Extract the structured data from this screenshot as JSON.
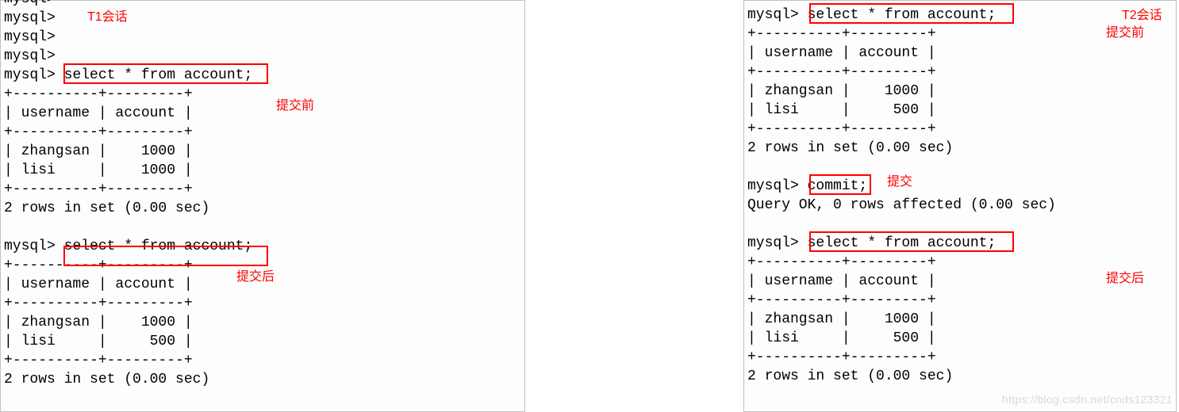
{
  "left": {
    "lines": [
      "mysql>",
      "mysql>",
      "mysql>",
      "mysql>",
      "mysql> select * from account;",
      "+----------+---------+",
      "| username | account |",
      "+----------+---------+",
      "| zhangsan |    1000 |",
      "| lisi     |    1000 |",
      "+----------+---------+",
      "2 rows in set (0.00 sec)",
      "",
      "mysql> select * from account;",
      "+----------+---------+",
      "| username | account |",
      "+----------+---------+",
      "| zhangsan |    1000 |",
      "| lisi     |     500 |",
      "+----------+---------+",
      "2 rows in set (0.00 sec)"
    ],
    "annotations": {
      "session": "T1会话",
      "before": "提交前",
      "after": "提交后"
    }
  },
  "right": {
    "lines": [
      "mysql> select * from account;",
      "+----------+---------+",
      "| username | account |",
      "+----------+---------+",
      "| zhangsan |    1000 |",
      "| lisi     |     500 |",
      "+----------+---------+",
      "2 rows in set (0.00 sec)",
      "",
      "mysql> commit;",
      "Query OK, 0 rows affected (0.00 sec)",
      "",
      "mysql> select * from account;",
      "+----------+---------+",
      "| username | account |",
      "+----------+---------+",
      "| zhangsan |    1000 |",
      "| lisi     |     500 |",
      "+----------+---------+",
      "2 rows in set (0.00 sec)"
    ],
    "annotations": {
      "session": "T2会话",
      "before": "提交前",
      "commit": "提交",
      "after": "提交后"
    }
  },
  "watermark": "https://blog.csdn.net/cnds123321"
}
